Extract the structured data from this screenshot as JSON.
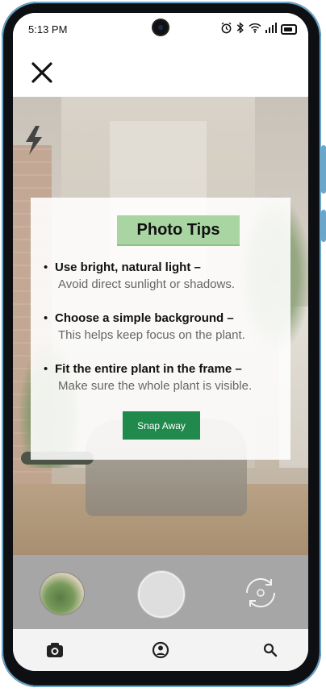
{
  "status_bar": {
    "time": "5:13 PM",
    "icons": [
      "alarm-icon",
      "bluetooth-icon",
      "wifi-icon",
      "signal-icon",
      "battery-icon"
    ]
  },
  "top_bar": {
    "close_icon": "close-icon"
  },
  "camera": {
    "flash_icon": "flash-icon"
  },
  "tips": {
    "title": "Photo Tips",
    "items": [
      {
        "bullet": "•",
        "heading": "Use bright, natural light –",
        "detail": "Avoid direct sunlight or shadows."
      },
      {
        "bullet": "•",
        "heading": "Choose a simple background –",
        "detail": "This helps keep focus on the plant."
      },
      {
        "bullet": "•",
        "heading": "Fit the entire plant in the frame –",
        "detail": "Make sure the whole plant is visible."
      }
    ],
    "button_label": "Snap Away"
  },
  "controls": {
    "gallery_icon": "gallery-thumbnail",
    "shutter_icon": "shutter-button",
    "flip_icon": "flip-camera-icon"
  },
  "bottom_nav": {
    "items": [
      "camera-icon",
      "profile-icon",
      "search-icon"
    ]
  },
  "colors": {
    "accent_green": "#1f8a4c",
    "title_highlight": "#a8d5a2",
    "controls_bg": "#a6a6a6"
  }
}
